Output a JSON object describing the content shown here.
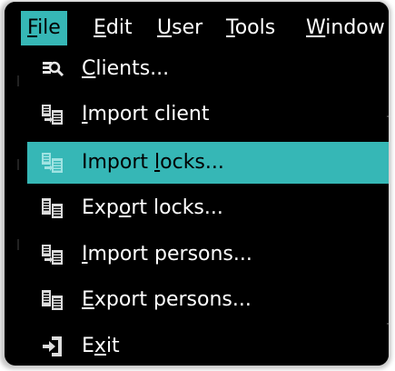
{
  "menubar": {
    "items": [
      {
        "pre": "",
        "u": "F",
        "post": "ile"
      },
      {
        "pre": "",
        "u": "E",
        "post": "dit"
      },
      {
        "pre": "",
        "u": "U",
        "post": "ser"
      },
      {
        "pre": "",
        "u": "T",
        "post": "ools"
      },
      {
        "pre": "",
        "u": "W",
        "post": "indow"
      }
    ]
  },
  "file_menu": {
    "items": [
      {
        "pre": "",
        "u": "C",
        "post": "lients...",
        "icon": "clients-search-icon"
      },
      {
        "pre": "",
        "u": "I",
        "post": "mport client",
        "icon": "import-icon"
      },
      {
        "pre": "Import ",
        "u": "l",
        "post": "ocks...",
        "icon": "import-icon"
      },
      {
        "pre": "Exp",
        "u": "o",
        "post": "rt locks...",
        "icon": "export-icon"
      },
      {
        "pre": "",
        "u": "I",
        "post": "mport persons...",
        "icon": "import-icon"
      },
      {
        "pre": "",
        "u": "E",
        "post": "xport persons...",
        "icon": "export-icon"
      },
      {
        "pre": "E",
        "u": "x",
        "post": "it",
        "icon": "exit-icon"
      }
    ]
  },
  "colors": {
    "highlight": "#36b7b6",
    "background": "#000000",
    "text": "#ffffff"
  }
}
